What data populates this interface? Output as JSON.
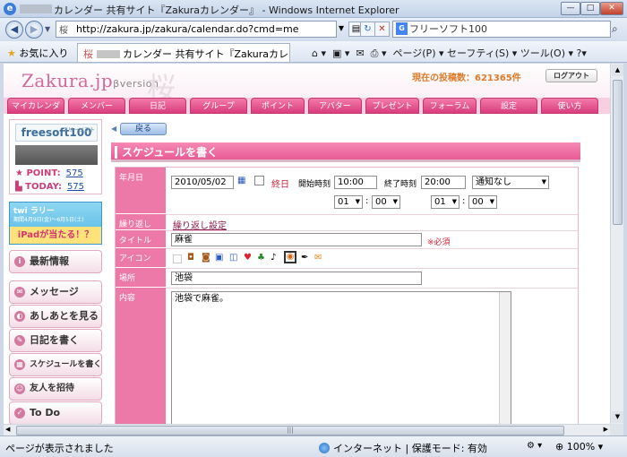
{
  "window": {
    "title": "カレンダー 共有サイト『Zakuraカレンダー』 - Windows Internet Explorer",
    "min": "—",
    "max": "□",
    "close": "✕"
  },
  "browser": {
    "url": "http://zakura.jp/zakura/calendar.do?cmd=me",
    "search_text": "フリーソフト100",
    "favorites": "お気に入り",
    "tab_title": "カレンダー 共有サイト『Zakuraカレン...",
    "tools": "ページ(P) ▾  セーフティ(S) ▾  ツール(O) ▾  ?▾",
    "status": "ページが表示されました",
    "zone": "インターネット | 保護モード: 有効",
    "zoom": "100%"
  },
  "site": {
    "logo": "Zakura.jp",
    "logo_beta": "βversion",
    "post_count": "現在の投稿数：621365件",
    "logout": "ログアウト",
    "nav": [
      "マイカレンダー",
      "メンバー",
      "日記",
      "グループ",
      "ポイント",
      "アバター",
      "プレゼント",
      "フォーラム",
      "設定",
      "使い方"
    ]
  },
  "sidebar": {
    "logo": "freesoft100",
    "logo_small": "フリーソフト",
    "point_label": "POINT:",
    "point_value": "575",
    "today_label": "TODAY:",
    "today_value": "575",
    "banner_top": "twi ラリー",
    "banner_date": "期間4月9日(金)～6月5日(土)",
    "banner_bottom": "iPadが当たる！？",
    "menu": [
      "最新情報",
      "メッセージ",
      "あしあとを見る",
      "日記を書く",
      "スケジュールを書く",
      "友人を招待",
      "To Do"
    ]
  },
  "content": {
    "back": "戻る",
    "title": "スケジュールを書く",
    "labels": {
      "date": "年月日",
      "repeat": "繰り返し",
      "title": "タイトル",
      "icon": "アイコン",
      "place": "場所",
      "body": "内容"
    },
    "date_value": "2010/05/02",
    "allday": "終日",
    "start_label": "開始時刻",
    "start_value": "10:00",
    "end_label": "終了時刻",
    "end_value": "20:00",
    "notify": "通知なし",
    "sh": "01",
    "sm": "00",
    "eh": "01",
    "em": "00",
    "repeat_link": "繰り返し設定",
    "title_value": "麻雀",
    "required": "※必須",
    "place_value": "池袋",
    "body_value": "池袋で麻雀。"
  }
}
